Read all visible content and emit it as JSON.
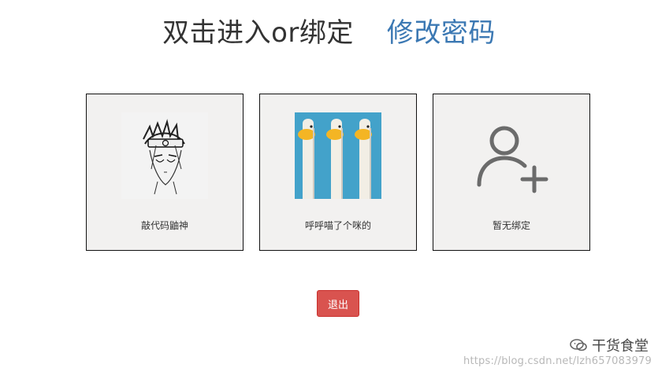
{
  "header": {
    "title": "双击进入or绑定",
    "change_password_link": "修改密码"
  },
  "cards": [
    {
      "label": "敲代码鼬神",
      "image": "sketch-avatar-image"
    },
    {
      "label": "呼呼喵了个咪的",
      "image": "ducks-image"
    },
    {
      "label": "暂无绑定",
      "image": "add-user-icon"
    }
  ],
  "actions": {
    "logout_label": "退出"
  },
  "watermark": {
    "brand": "干货食堂",
    "url": "https://blog.csdn.net/lzh657083979"
  },
  "colors": {
    "link": "#3b78b3",
    "logout_bg": "#d9534f",
    "card_bg": "#f2f1f0"
  }
}
